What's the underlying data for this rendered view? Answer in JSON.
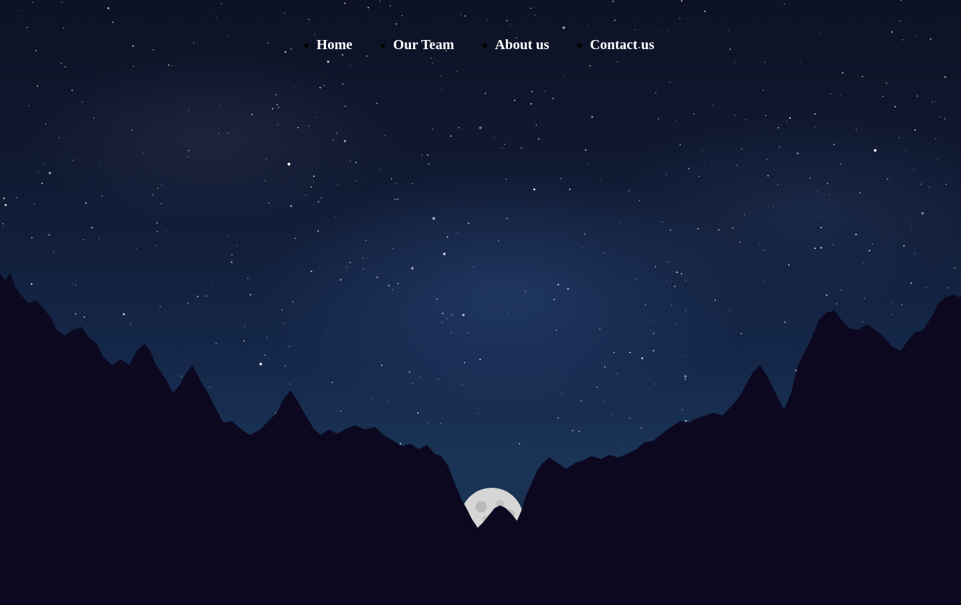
{
  "nav": {
    "items": [
      {
        "label": "Home"
      },
      {
        "label": "Our Team"
      },
      {
        "label": "About us"
      },
      {
        "label": "Contact us"
      }
    ]
  },
  "colors": {
    "sky_top": "#0d1224",
    "sky_bottom": "#1b3558",
    "forest": "#0b0820",
    "moon": "#d8d8d8",
    "nav_text": "#ffffff"
  },
  "icons": {
    "moon": "moon-icon"
  }
}
